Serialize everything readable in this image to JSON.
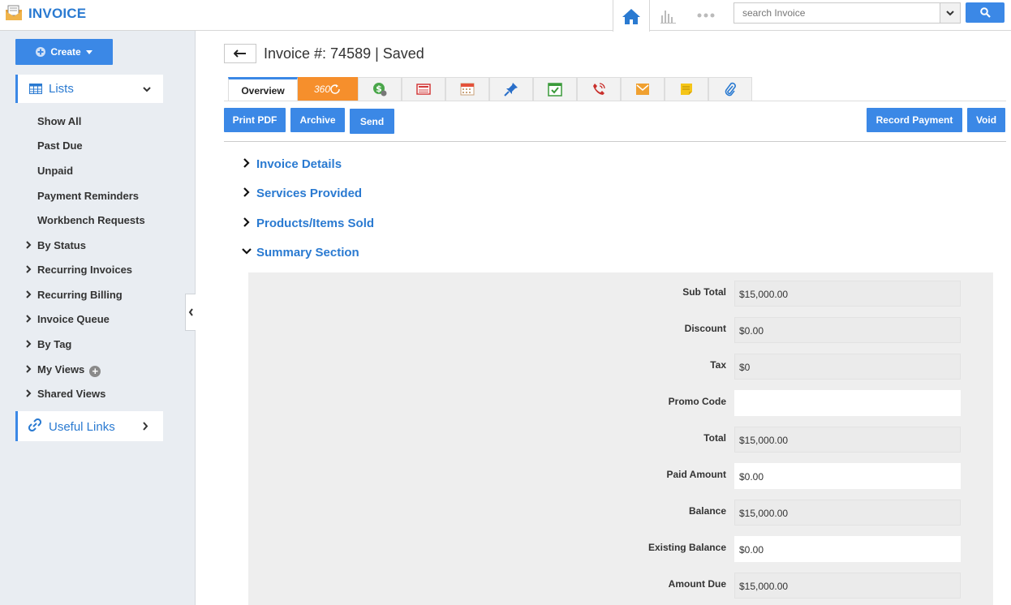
{
  "app": {
    "title": "INVOICE"
  },
  "colors": {
    "accent": "#3b88e6",
    "link": "#2a7ad1",
    "tab360": "#f68f2c"
  },
  "search": {
    "placeholder": "search Invoice"
  },
  "topnav": {
    "icons": [
      "home-icon",
      "chart-icon",
      "more-icon"
    ]
  },
  "sidebar": {
    "create_label": "Create",
    "lists_label": "Lists",
    "items": [
      "Show All",
      "Past Due",
      "Unpaid",
      "Payment Reminders",
      "Workbench Requests"
    ],
    "groups": [
      "By Status",
      "Recurring Invoices",
      "Recurring Billing",
      "Invoice Queue",
      "By Tag",
      "My Views",
      "Shared Views"
    ],
    "useful_links": "Useful Links"
  },
  "header": {
    "title": "Invoice #: 74589 | Saved"
  },
  "tabs": {
    "overview": "Overview",
    "t360": "360",
    "icons": [
      "dollar-icon",
      "news-icon",
      "calendar-icon",
      "pin-icon",
      "task-icon",
      "phone-icon",
      "email-icon",
      "note-icon",
      "attachment-icon"
    ]
  },
  "actions": {
    "print_pdf": "Print PDF",
    "archive": "Archive",
    "send": "Send",
    "record_payment": "Record Payment",
    "void": "Void"
  },
  "sections": [
    "Invoice Details",
    "Services Provided",
    "Products/Items Sold",
    "Summary Section"
  ],
  "summary": [
    {
      "label": "Sub Total",
      "value": "$15,000.00",
      "editable": false
    },
    {
      "label": "Discount",
      "value": "$0.00",
      "editable": false
    },
    {
      "label": "Tax",
      "value": "$0",
      "editable": false
    },
    {
      "label": "Promo Code",
      "value": "",
      "editable": true
    },
    {
      "label": "Total",
      "value": "$15,000.00",
      "editable": false
    },
    {
      "label": "Paid Amount",
      "value": "$0.00",
      "editable": true
    },
    {
      "label": "Balance",
      "value": "$15,000.00",
      "editable": false
    },
    {
      "label": "Existing Balance",
      "value": "$0.00",
      "editable": true
    },
    {
      "label": "Amount Due",
      "value": "$15,000.00",
      "editable": false
    }
  ]
}
